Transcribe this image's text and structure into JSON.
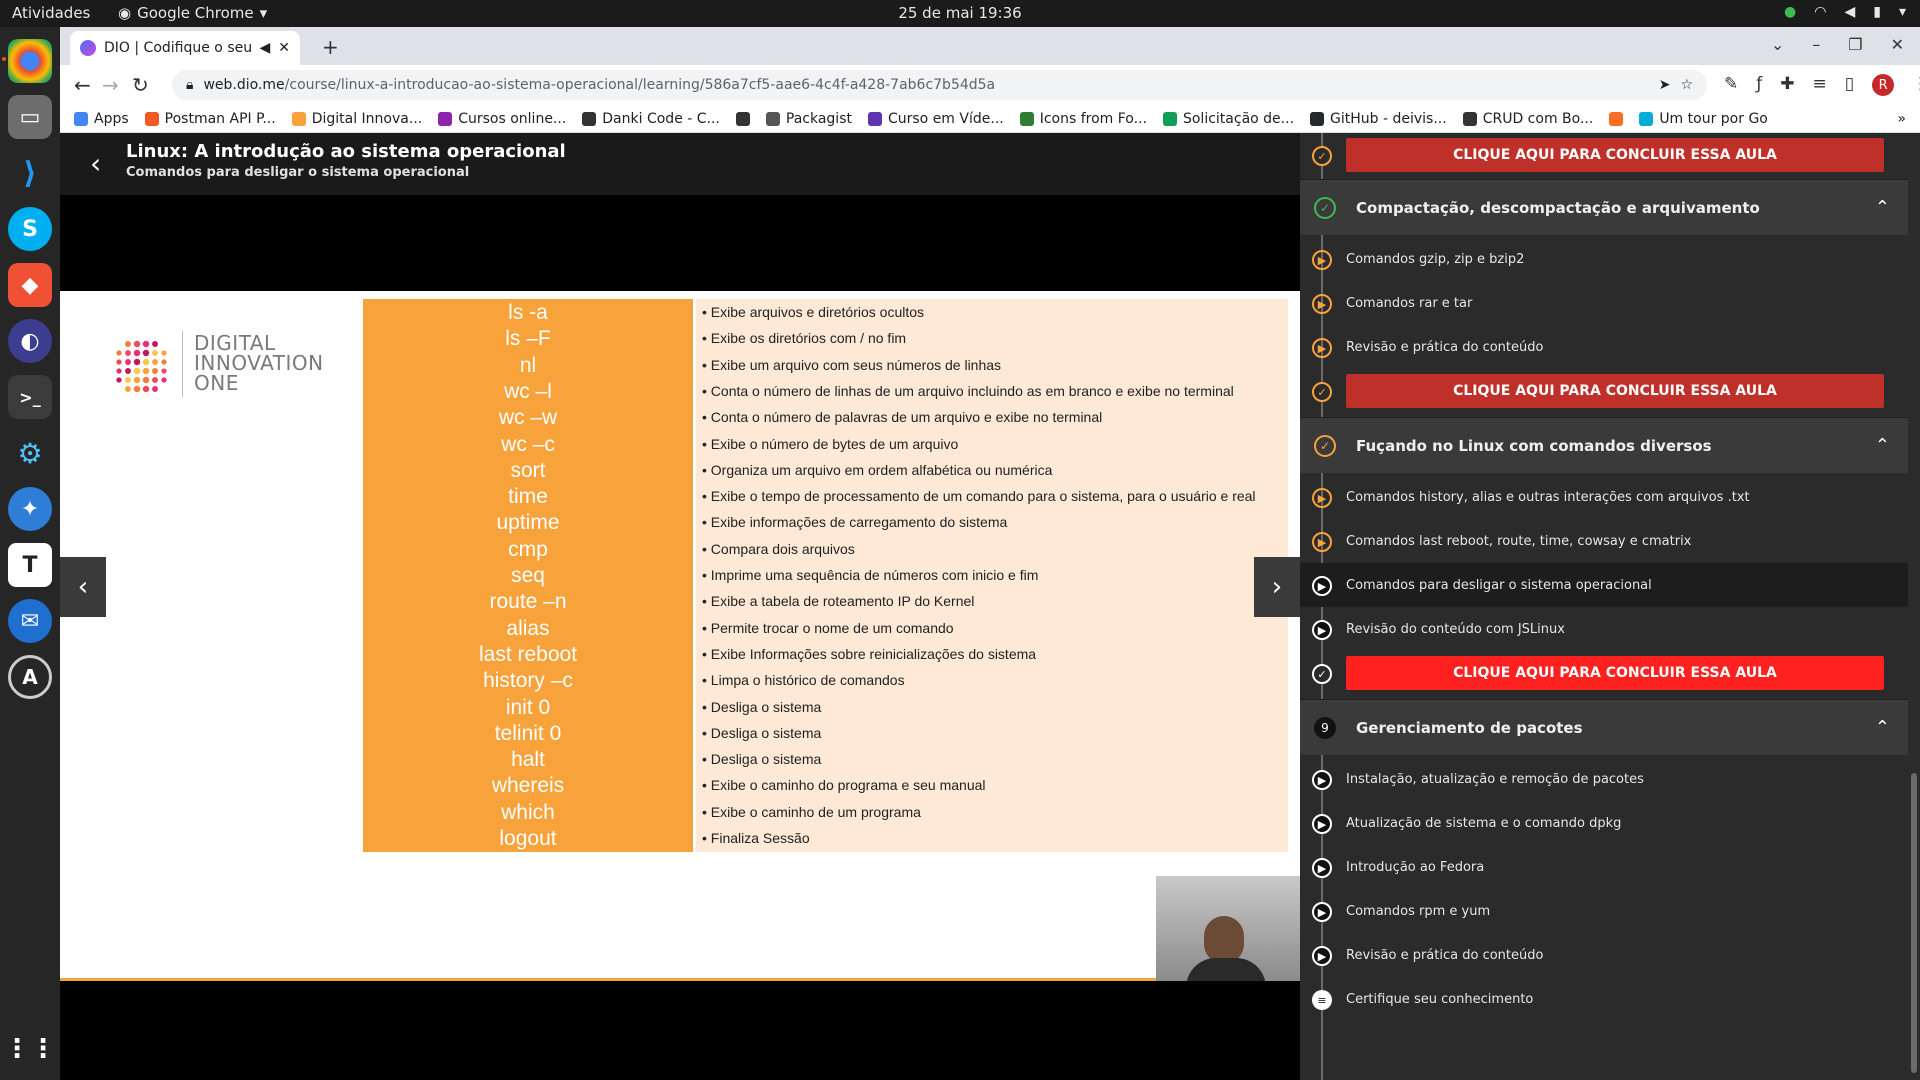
{
  "topbar": {
    "activities": "Atividades",
    "app": "Google Chrome",
    "clock": "25 de mai  19:36"
  },
  "browser": {
    "tab_title": "DIO | Codifique o seu f",
    "url_host": "web.dio.me",
    "url_path": "/course/linux-a-introducao-ao-sistema-operacional/learning/586a7cf5-aae6-4c4f-a428-7ab6c7b54d5a",
    "bookmarks": [
      {
        "label": "Apps",
        "color": "#4285f4"
      },
      {
        "label": "Postman API P...",
        "color": "#ef5b25"
      },
      {
        "label": "Digital Innova...",
        "color": "#f7a23b"
      },
      {
        "label": "Cursos online...",
        "color": "#8e24aa"
      },
      {
        "label": "Danki Code - C...",
        "color": "#333333"
      },
      {
        "label": "",
        "color": "#333333"
      },
      {
        "label": "Packagist",
        "color": "#555555"
      },
      {
        "label": "Curso em Víde...",
        "color": "#5e35b1"
      },
      {
        "label": "Icons from Fo...",
        "color": "#2e7d32"
      },
      {
        "label": "Solicitação de...",
        "color": "#0f9d58"
      },
      {
        "label": "GitHub - deivis...",
        "color": "#24292e"
      },
      {
        "label": "CRUD com Bo...",
        "color": "#333333"
      },
      {
        "label": "",
        "color": "#fc6d26"
      },
      {
        "label": "Um tour por Go",
        "color": "#00add8"
      }
    ]
  },
  "lesson": {
    "course_title": "Linux: A introdução ao sistema operacional",
    "lesson_title": "Comandos para desligar o sistema operacional"
  },
  "slide": {
    "logo_text": [
      "DIGITAL",
      "INNOVATION",
      "ONE"
    ],
    "rows": [
      {
        "cmd": "ls -a",
        "desc": "• Exibe arquivos e diretórios ocultos"
      },
      {
        "cmd": "ls –F",
        "desc": "• Exibe os diretórios com / no fim"
      },
      {
        "cmd": "nl",
        "desc": "• Exibe um arquivo com seus números de linhas"
      },
      {
        "cmd": "wc –l",
        "desc": "• Conta o número de linhas de um arquivo incluindo as em branco e exibe no terminal"
      },
      {
        "cmd": "wc –w",
        "desc": "• Conta o número de palavras de um arquivo e exibe no terminal"
      },
      {
        "cmd": "wc –c",
        "desc": "• Exibe o número de bytes de um arquivo"
      },
      {
        "cmd": "sort",
        "desc": "• Organiza um arquivo em ordem alfabética ou numérica"
      },
      {
        "cmd": "time",
        "desc": "• Exibe o tempo de processamento de um comando para o sistema, para o usuário e real"
      },
      {
        "cmd": "uptime",
        "desc": "• Exibe informações de carregamento do sistema"
      },
      {
        "cmd": "cmp",
        "desc": "• Compara dois arquivos"
      },
      {
        "cmd": "seq",
        "desc": "• Imprime uma sequência de números com inicio e fim"
      },
      {
        "cmd": "route –n",
        "desc": "• Exibe a tabela de roteamento IP do Kernel"
      },
      {
        "cmd": "alias",
        "desc": "• Permite trocar o nome de um comando"
      },
      {
        "cmd": "last reboot",
        "desc": "• Exibe Informações sobre reinicializações do sistema"
      },
      {
        "cmd": "history –c",
        "desc": "• Limpa o histórico de comandos"
      },
      {
        "cmd": "init 0",
        "desc": "• Desliga o sistema"
      },
      {
        "cmd": "telinit 0",
        "desc": "• Desliga o sistema"
      },
      {
        "cmd": "halt",
        "desc": "• Desliga o sistema"
      },
      {
        "cmd": "whereis",
        "desc": "• Exibe o caminho do programa e seu manual"
      },
      {
        "cmd": "which",
        "desc": "• Exibe o caminho de um programa"
      },
      {
        "cmd": "logout",
        "desc": "• Finaliza Sessão"
      }
    ]
  },
  "panel": {
    "finish_label": "CLIQUE AQUI PARA CONCLUIR ESSA AULA",
    "sections": [
      {
        "title": "Compactação, descompactação e arquivamento",
        "badge": "",
        "items": [
          "Comandos gzip, zip e bzip2",
          "Comandos rar e tar",
          "Revisão e prática do conteúdo"
        ]
      },
      {
        "title": "Fuçando no Linux com comandos diversos",
        "badge": "",
        "items": [
          "Comandos history, alias e outras interações com arquivos .txt",
          "Comandos last reboot, route, time, cowsay e cmatrix",
          "Comandos para desligar o sistema operacional",
          "Revisão do conteúdo com JSLinux"
        ]
      },
      {
        "title": "Gerenciamento de pacotes",
        "badge": "9",
        "items": [
          "Instalação, atualização e remoção de pacotes",
          "Atualização de sistema e o comando dpkg",
          "Introdução ao Fedora",
          "Comandos rpm e yum",
          "Revisão e prática do conteúdo",
          "Certifique seu conhecimento"
        ]
      }
    ]
  },
  "colors": {
    "accent": "#f7a23b",
    "finish_dim": "#c0302b",
    "finish_bright": "#ff2020",
    "check_green": "#3fb950"
  }
}
